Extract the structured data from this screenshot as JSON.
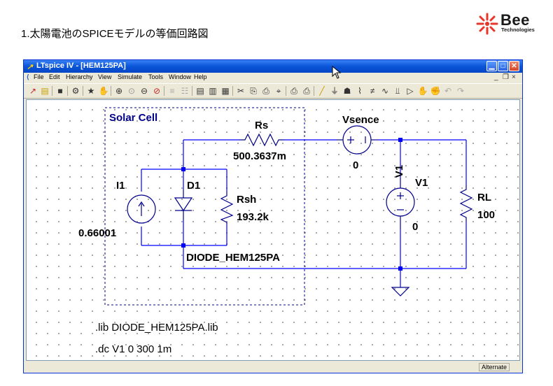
{
  "slide": {
    "heading": "1.太陽電池のSPICEモデルの等価回路図",
    "logo_name": "Bee",
    "logo_tagline": "Technologies"
  },
  "window": {
    "title": "LTspice IV - [HEM125PA]",
    "menu": [
      "File",
      "Edit",
      "Hierarchy",
      "View",
      "Simulate",
      "Tools",
      "Window",
      "Help"
    ],
    "status": "Alternate"
  },
  "schematic": {
    "box_label": "Solar Cell",
    "rs_name": "Rs",
    "rs_value": "500.3637m",
    "i1_name": "I1",
    "i1_value": "0.66001",
    "d1_name": "D1",
    "d1_model": "DIODE_HEM125PA",
    "rsh_name": "Rsh",
    "rsh_value": "193.2k",
    "vsence_name": "Vsence",
    "vsence_value": "0",
    "v1_netlabel": "V1",
    "v1_name": "V1",
    "v1_value": "0",
    "rl_name": "RL",
    "rl_value": "100",
    "directive_lib": ".lib DIODE_HEM125PA.lib",
    "directive_dc": ".dc V1 0 300 1m"
  },
  "colors": {
    "wire": "#0000ff",
    "component": "#00008b",
    "label": "#000000",
    "solar_label": "#00008b",
    "titlebar": "#0a55d8"
  }
}
